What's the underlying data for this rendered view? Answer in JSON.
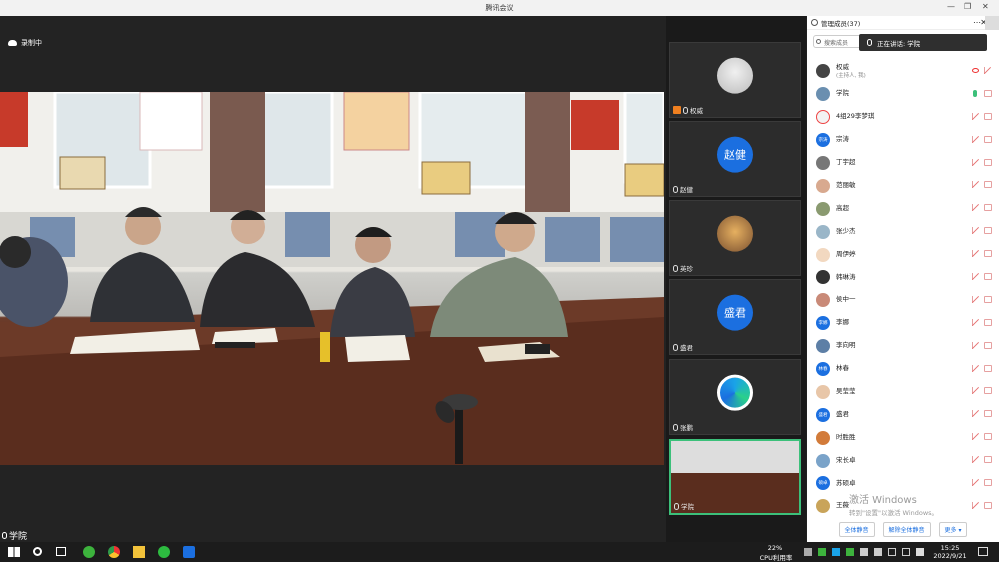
{
  "window": {
    "title": "腾讯会议"
  },
  "recording": {
    "label": "录制中"
  },
  "main_speaker": {
    "name": "学院"
  },
  "thumbnails": [
    {
      "name": "权威",
      "kind": "photo"
    },
    {
      "name": "赵健",
      "kind": "avatar",
      "avatar_text": "赵健"
    },
    {
      "name": "英珍",
      "kind": "photo"
    },
    {
      "name": "盛君",
      "kind": "avatar",
      "avatar_text": "盛君"
    },
    {
      "name": "张鹏",
      "kind": "dev"
    },
    {
      "name": "学院",
      "kind": "video"
    }
  ],
  "panel": {
    "title": "管理成员(37)",
    "search_placeholder": "搜索成员",
    "now_speaking": "正在讲话: 学院",
    "members": [
      {
        "name": "权威",
        "sub": "(主持人, 我)",
        "avatar": "",
        "status": "host"
      },
      {
        "name": "学院",
        "sub": "",
        "avatar": "",
        "status": "mic-on"
      },
      {
        "name": "4组29李梦琪",
        "sub": "",
        "avatar": "",
        "status": "off"
      },
      {
        "name": "宗涛",
        "sub": "",
        "avatar": "宗涛",
        "status": "off"
      },
      {
        "name": "丁宇超",
        "sub": "",
        "avatar": "",
        "status": "off"
      },
      {
        "name": "范丽敏",
        "sub": "",
        "avatar": "",
        "status": "off"
      },
      {
        "name": "高超",
        "sub": "",
        "avatar": "",
        "status": "off"
      },
      {
        "name": "张少杰",
        "sub": "",
        "avatar": "",
        "status": "off"
      },
      {
        "name": "周伊婷",
        "sub": "",
        "avatar": "",
        "status": "off"
      },
      {
        "name": "韩琳涛",
        "sub": "",
        "avatar": "",
        "status": "off"
      },
      {
        "name": "侯中一",
        "sub": "",
        "avatar": "",
        "status": "off"
      },
      {
        "name": "李娜",
        "sub": "",
        "avatar": "李娜",
        "status": "off"
      },
      {
        "name": "李向明",
        "sub": "",
        "avatar": "",
        "status": "off"
      },
      {
        "name": "林春",
        "sub": "",
        "avatar": "林春",
        "status": "off"
      },
      {
        "name": "吴莹莹",
        "sub": "",
        "avatar": "",
        "status": "off"
      },
      {
        "name": "盛君",
        "sub": "",
        "avatar": "盛君",
        "status": "off"
      },
      {
        "name": "时胜胜",
        "sub": "",
        "avatar": "",
        "status": "off"
      },
      {
        "name": "宋长卓",
        "sub": "",
        "avatar": "",
        "status": "off"
      },
      {
        "name": "苏硕卓",
        "sub": "",
        "avatar": "硕卓",
        "status": "off"
      },
      {
        "name": "王薇",
        "sub": "",
        "avatar": "",
        "status": "off"
      }
    ],
    "buttons": {
      "mute_all": "全体静音",
      "unmute_all": "解除全体静音",
      "more": "更多 ▾"
    }
  },
  "watermark": {
    "line1": "激活 Windows",
    "line2": "转到\"设置\"以激活 Windows。"
  },
  "taskbar": {
    "cpu_pct": "22%",
    "cpu_label": "CPU利用率",
    "time": "15:25",
    "date": "2022/9/21"
  }
}
